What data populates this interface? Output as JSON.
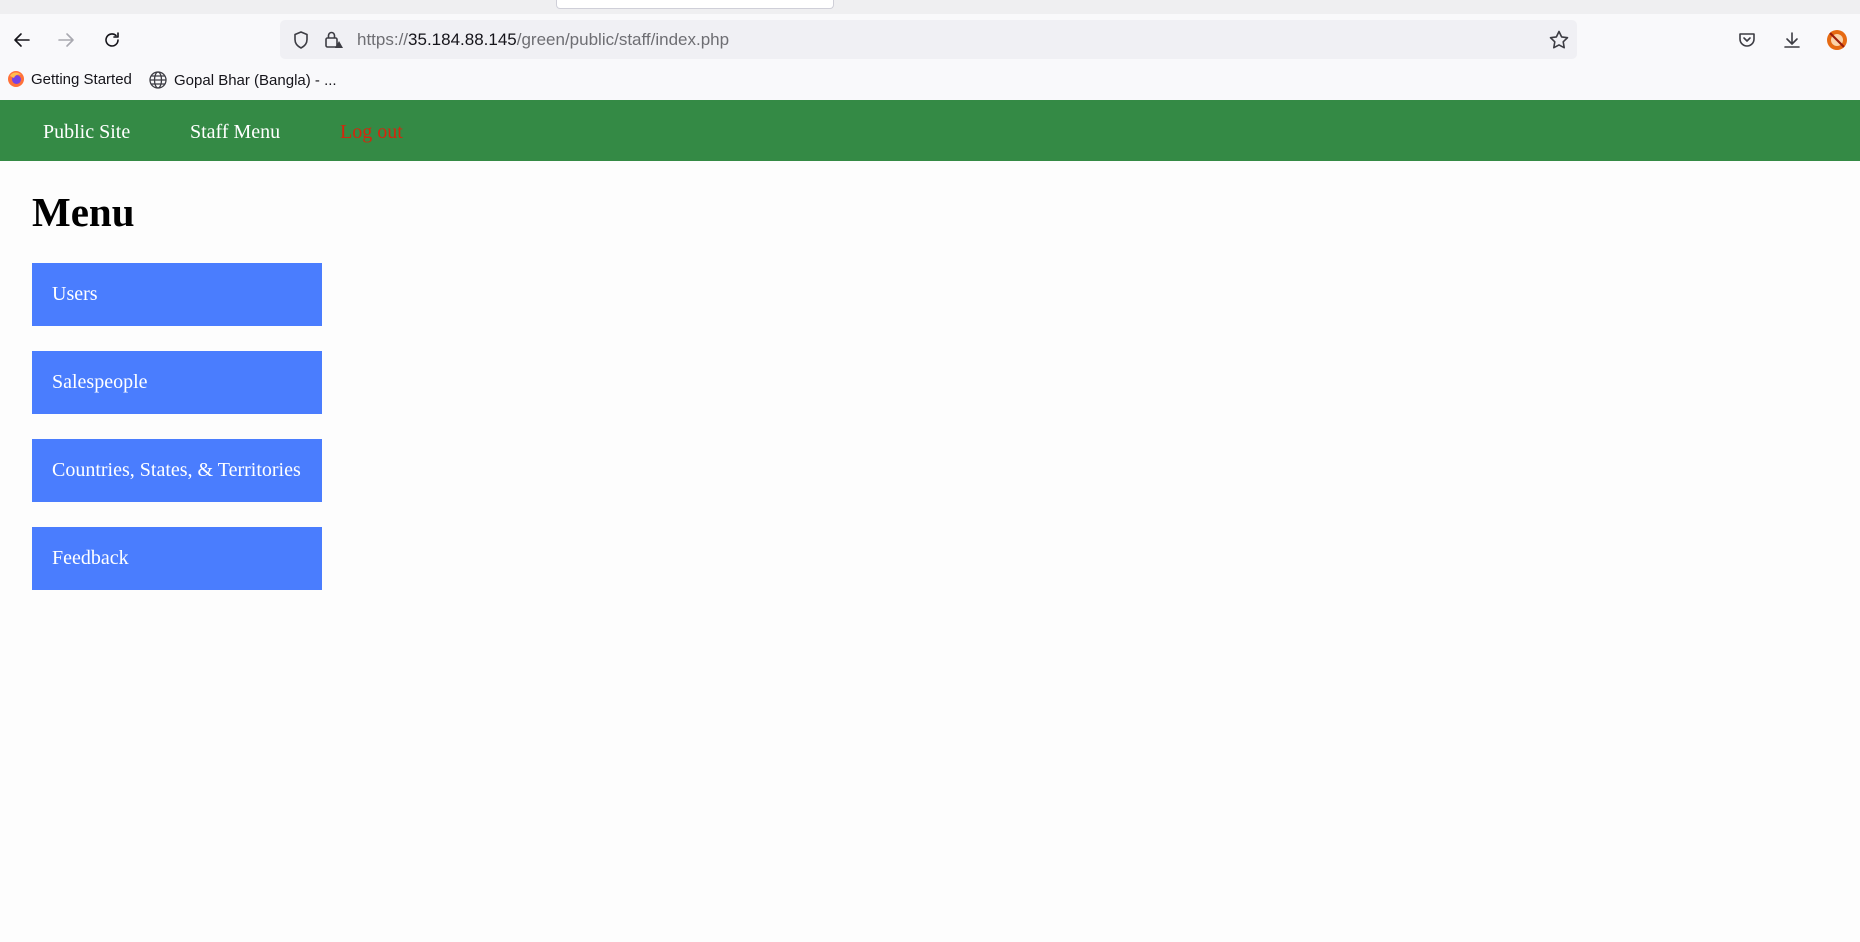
{
  "browser": {
    "url": {
      "scheme": "https://",
      "host": "35.184.88.145",
      "path": "/green/public/staff/index.php"
    },
    "bookmarks": [
      {
        "label": "Getting Started",
        "icon": "firefox-icon"
      },
      {
        "label": "Gopal Bhar (Bangla) - ...",
        "icon": "globe-icon"
      }
    ]
  },
  "nav": {
    "public_site": "Public Site",
    "staff_menu": "Staff Menu",
    "log_out": "Log out"
  },
  "main": {
    "title": "Menu",
    "items": [
      {
        "label": "Users"
      },
      {
        "label": "Salespeople"
      },
      {
        "label": "Countries, States, & Territories"
      },
      {
        "label": "Feedback"
      }
    ]
  },
  "colors": {
    "nav_background": "#348a45",
    "logout_text": "#d4260d",
    "menu_button": "#4a7dfe"
  }
}
